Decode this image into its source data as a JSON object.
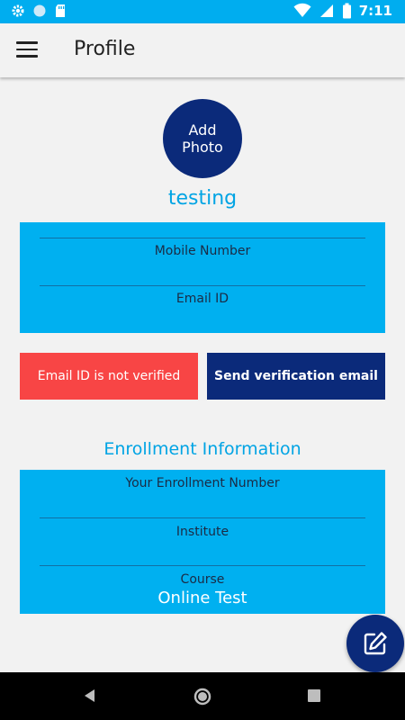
{
  "status_bar": {
    "time": "7:11"
  },
  "header": {
    "title": "Profile"
  },
  "profile": {
    "add_photo_line1": "Add",
    "add_photo_line2": "Photo",
    "username": "testing",
    "mobile_label": "Mobile Number",
    "email_label": "Email ID"
  },
  "verification": {
    "status_text": "Email ID is not verified",
    "send_button": "Send verification email"
  },
  "enrollment": {
    "title": "Enrollment Information",
    "enrollment_number_label": "Your Enrollment Number",
    "institute_label": "Institute",
    "course_label": "Course",
    "course_value": "Online Test"
  },
  "colors": {
    "accent": "#00b0f0",
    "primary": "#0b2a7a",
    "warning": "#f84545"
  }
}
